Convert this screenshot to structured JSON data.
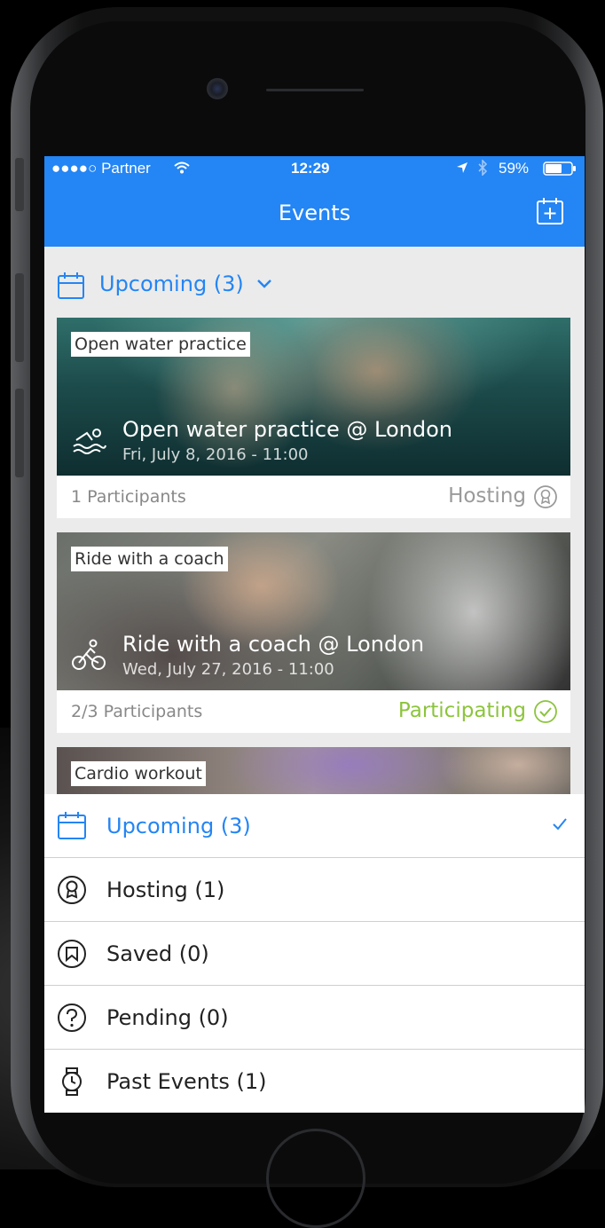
{
  "status_bar": {
    "carrier": "●●●●○ Partner",
    "time": "12:29",
    "battery": "59%"
  },
  "nav": {
    "title": "Events"
  },
  "filter": {
    "label": "Upcoming (3)"
  },
  "events": [
    {
      "tag": "Open water practice",
      "title": "Open water practice @ London",
      "date": "Fri, July 8, 2016 - 11:00",
      "participants": "1 Participants",
      "status": "Hosting",
      "status_color": "#9a9a9a",
      "icon": "swimmer-icon"
    },
    {
      "tag": "Ride with a coach",
      "title": "Ride with a coach @ London",
      "date": "Wed, July 27, 2016 - 11:00",
      "participants": "2/3 Participants",
      "status": "Participating",
      "status_color": "#8cc43c",
      "icon": "cyclist-icon"
    },
    {
      "tag": "Cardio workout"
    }
  ],
  "sheet": {
    "items": [
      {
        "label": "Upcoming (3)",
        "icon": "calendar-icon",
        "selected": true
      },
      {
        "label": "Hosting (1)",
        "icon": "hosting-badge-icon"
      },
      {
        "label": "Saved  (0)",
        "icon": "saved-bookmark-icon"
      },
      {
        "label": "Pending (0)",
        "icon": "question-icon"
      },
      {
        "label": "Past Events (1)",
        "icon": "watch-icon"
      }
    ]
  },
  "colors": {
    "accent": "#2485f4",
    "participating": "#8cc43c",
    "hosting": "#9a9a9a"
  }
}
